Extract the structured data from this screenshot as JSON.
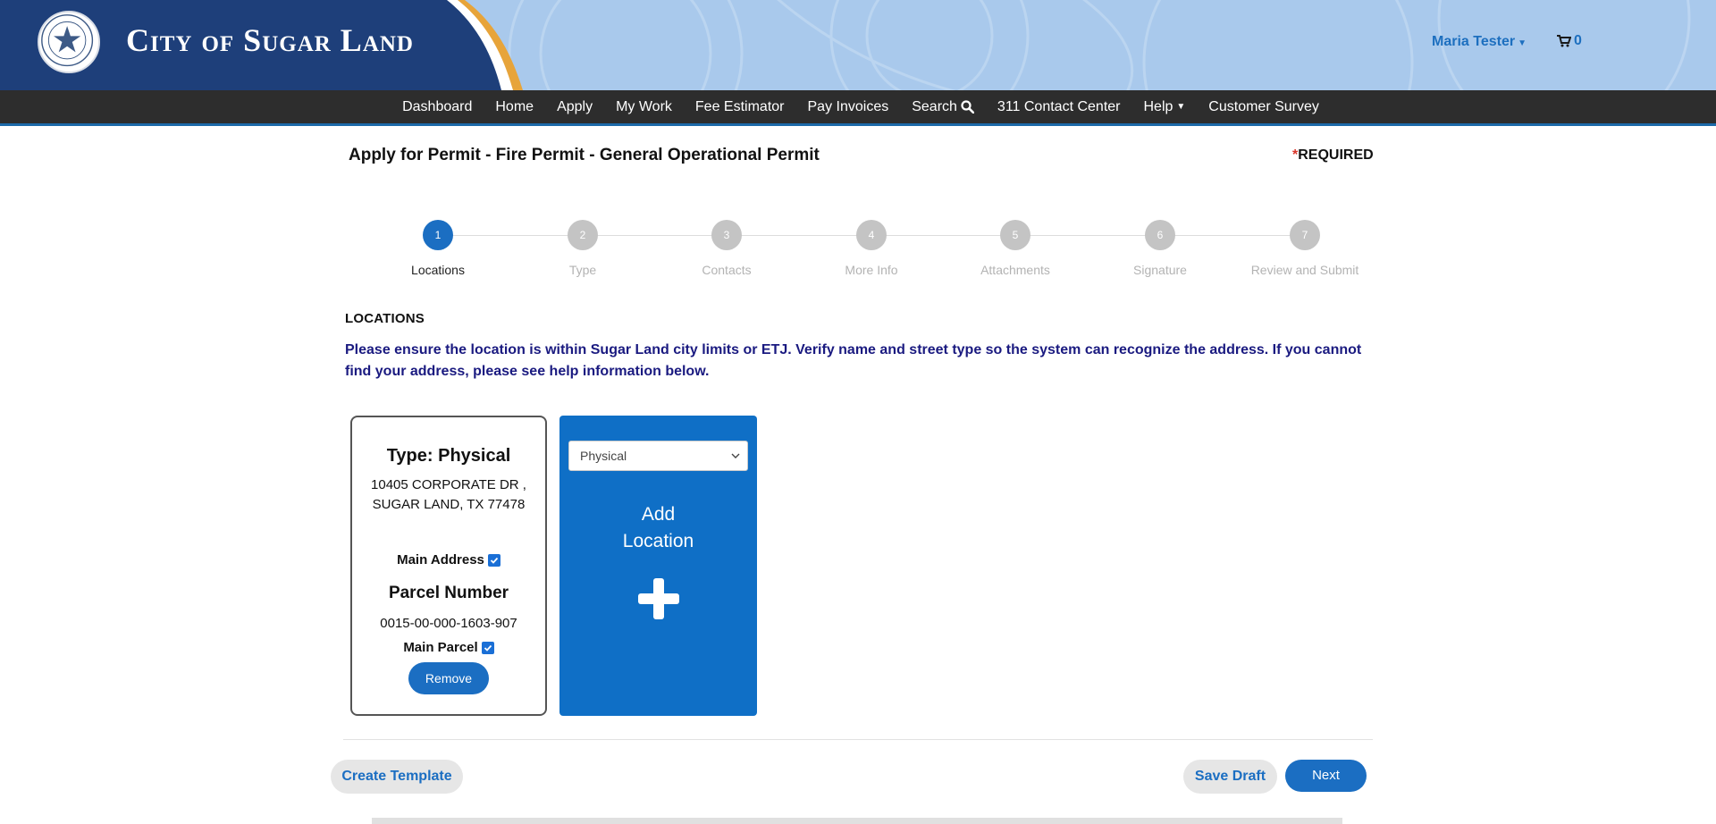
{
  "header": {
    "city_name": "City of Sugar Land",
    "seal_text": "City of Sugar Land Texas",
    "user_name": "Maria Tester",
    "cart_count": "0"
  },
  "nav": {
    "items": [
      {
        "label": "Dashboard"
      },
      {
        "label": "Home"
      },
      {
        "label": "Apply"
      },
      {
        "label": "My Work"
      },
      {
        "label": "Fee Estimator"
      },
      {
        "label": "Pay Invoices"
      },
      {
        "label": "Search"
      },
      {
        "label": "311 Contact Center"
      },
      {
        "label": "Help"
      },
      {
        "label": "Customer Survey"
      }
    ]
  },
  "page": {
    "title": "Apply for Permit - Fire Permit - General Operational Permit",
    "required_star": "*",
    "required_label": "REQUIRED"
  },
  "stepper": {
    "steps": [
      {
        "number": "1",
        "label": "Locations"
      },
      {
        "number": "2",
        "label": "Type"
      },
      {
        "number": "3",
        "label": "Contacts"
      },
      {
        "number": "4",
        "label": "More Info"
      },
      {
        "number": "5",
        "label": "Attachments"
      },
      {
        "number": "6",
        "label": "Signature"
      },
      {
        "number": "7",
        "label": "Review and Submit"
      }
    ],
    "active_step": 1
  },
  "locations": {
    "heading": "LOCATIONS",
    "notice": "Please ensure the location is within Sugar Land city limits or ETJ. Verify name and street type so the system can recognize the address.  If you cannot find your address, please see help information below.",
    "card": {
      "type_label": "Type: Physical",
      "address_line1": "10405 CORPORATE DR ,",
      "address_line2": "SUGAR LAND, TX 77478",
      "main_address_label": "Main Address",
      "main_address_checked": true,
      "parcel_title": "Parcel Number",
      "parcel_number": "0015-00-000-1603-907",
      "main_parcel_label": "Main Parcel",
      "main_parcel_checked": true,
      "remove_label": "Remove"
    },
    "add_tile": {
      "select_value": "Physical",
      "label_line1": "Add",
      "label_line2": "Location"
    }
  },
  "footer": {
    "create_template": "Create Template",
    "save_draft": "Save Draft",
    "next": "Next"
  },
  "colors": {
    "primary": "#1b6ec2",
    "header_dark": "#1e3f7a",
    "header_light": "#a9c9ec",
    "nav_bg": "#2d2d2d",
    "notice_text": "#1a1a80",
    "accent_gold": "#e7a43a"
  }
}
